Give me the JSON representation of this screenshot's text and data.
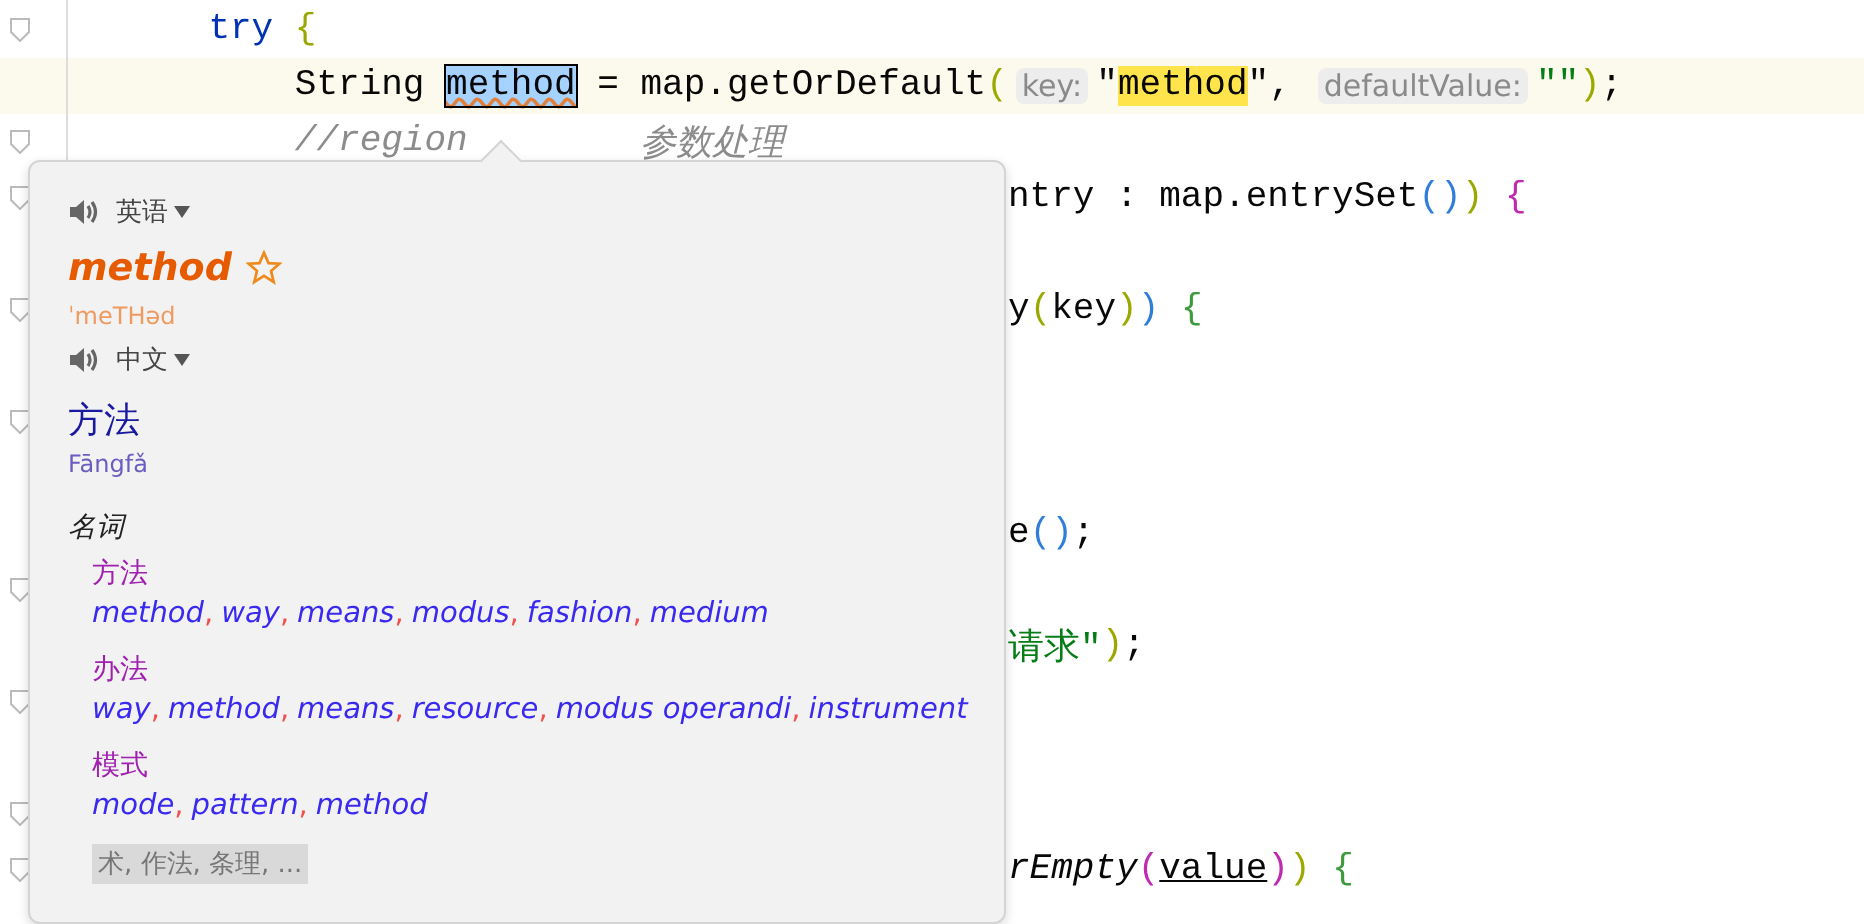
{
  "editor": {
    "rows": [
      {
        "fold": true,
        "code": [
          {
            "kind": "keyword",
            "text": "    try"
          },
          {
            "kind": "brace",
            "text": "{",
            "color": "#9aa800",
            "gap": true
          }
        ]
      },
      {
        "current": true,
        "code": [
          {
            "kind": "plain",
            "text": "        String "
          },
          {
            "kind": "selected",
            "text": "method"
          },
          {
            "kind": "plain",
            "text": " = map.getOrDefault"
          },
          {
            "kind": "brace",
            "text": "(",
            "color": "#9aa800"
          },
          {
            "kind": "hint",
            "text": "key:"
          },
          {
            "kind": "quote",
            "text": "\""
          },
          {
            "kind": "match",
            "text": "method"
          },
          {
            "kind": "quote",
            "text": "\""
          },
          {
            "kind": "plain",
            "text": ","
          },
          {
            "kind": "hint",
            "text": "defaultValue:",
            "gap": true
          },
          {
            "kind": "string",
            "text": "\"\""
          },
          {
            "kind": "brace",
            "text": ")",
            "color": "#9aa800"
          },
          {
            "kind": "plain",
            "text": ";"
          }
        ]
      },
      {
        "fold": true,
        "code": [
          {
            "kind": "comment",
            "text": "        //region"
          },
          {
            "kind": "comment",
            "text": "参数处理",
            "tab": true
          }
        ]
      },
      {
        "fold": true,
        "tail": [
          {
            "kind": "plain",
            "text": "ntry : map.entrySet"
          },
          {
            "kind": "brace",
            "text": "()",
            "color": "#2f7fd8"
          },
          {
            "kind": "brace",
            "text": ")",
            "color": "#9aa800"
          },
          {
            "kind": "brace",
            "text": "{",
            "color": "#c02ab0",
            "gap": true
          }
        ]
      },
      {},
      {
        "fold": true,
        "tail": [
          {
            "kind": "plain",
            "text": "y"
          },
          {
            "kind": "brace",
            "text": "(",
            "color": "#9aa800"
          },
          {
            "kind": "plain",
            "text": "key"
          },
          {
            "kind": "brace",
            "text": ")",
            "color": "#9aa800"
          },
          {
            "kind": "brace",
            "text": ")",
            "color": "#2f7fd8"
          },
          {
            "kind": "brace",
            "text": "{",
            "color": "#3d9a3d",
            "gap": true
          }
        ]
      },
      {},
      {
        "fold": true
      },
      {},
      {
        "tail": [
          {
            "kind": "plain",
            "text": "e"
          },
          {
            "kind": "brace",
            "text": "()",
            "color": "#2f7fd8"
          },
          {
            "kind": "plain",
            "text": ";"
          }
        ]
      },
      {
        "fold": true
      },
      {
        "tail": [
          {
            "kind": "string",
            "text": "请求\""
          },
          {
            "kind": "brace",
            "text": ")",
            "color": "#9aa800"
          },
          {
            "kind": "plain",
            "text": ";"
          }
        ]
      },
      {
        "fold": true
      },
      {},
      {
        "fold": true
      },
      {
        "fold": true,
        "tail": [
          {
            "kind": "italic",
            "text": "rEmpty"
          },
          {
            "kind": "brace",
            "text": "(",
            "color": "#c02ab0"
          },
          {
            "kind": "underline",
            "text": "value"
          },
          {
            "kind": "brace",
            "text": ")",
            "color": "#c02ab0"
          },
          {
            "kind": "brace",
            "text": ")",
            "color": "#9aa800"
          },
          {
            "kind": "brace",
            "text": "{",
            "color": "#3d9a3d",
            "gap": true
          }
        ]
      }
    ]
  },
  "dictionary_popup": {
    "source_language": "英语",
    "word": "method",
    "starred": false,
    "phonetic": "ˈmeTHəd",
    "target_language": "中文",
    "translation": "方法",
    "pinyin": "Fāngfǎ",
    "part_of_speech": "名词",
    "senses": [
      {
        "heading": "方法",
        "synonyms": [
          {
            "word": "method",
            "sep": ","
          },
          {
            "word": "way",
            "sep": ","
          },
          {
            "word": "means",
            "sep": ","
          },
          {
            "word": "modus",
            "sep": ","
          },
          {
            "word": "fashion",
            "sep": ","
          },
          {
            "word": "medium"
          }
        ]
      },
      {
        "heading": "办法",
        "synonyms": [
          {
            "word": "way",
            "sep": ","
          },
          {
            "word": "method",
            "sep": ","
          },
          {
            "word": "means",
            "sep": ","
          },
          {
            "word": "resource",
            "sep": ","
          },
          {
            "word": "modus operandi",
            "sep": ","
          },
          {
            "word": "instrument"
          }
        ]
      },
      {
        "heading": "模式",
        "synonyms": [
          {
            "word": "mode",
            "sep": ","
          },
          {
            "word": "pattern",
            "sep": ","
          },
          {
            "word": "method"
          }
        ]
      }
    ],
    "more": "术, 作法, 条理, ..."
  }
}
